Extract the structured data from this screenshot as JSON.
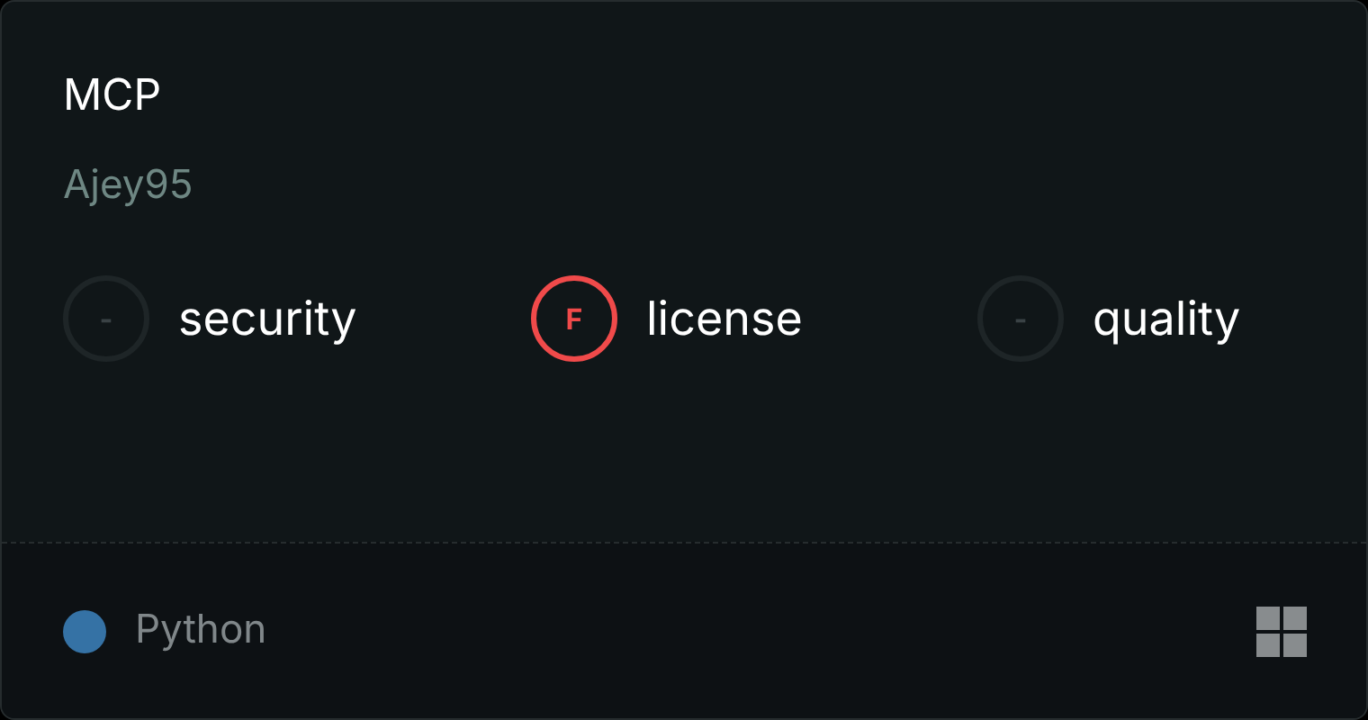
{
  "title": "MCP",
  "author": "Ajey95",
  "scores": [
    {
      "kind": "empty",
      "grade": "-",
      "label": "security"
    },
    {
      "kind": "failing",
      "grade": "F",
      "label": "license"
    },
    {
      "kind": "empty",
      "grade": "-",
      "label": "quality"
    }
  ],
  "footer": {
    "languages": [
      {
        "name": "Python",
        "color": "#3572a5"
      }
    ]
  }
}
